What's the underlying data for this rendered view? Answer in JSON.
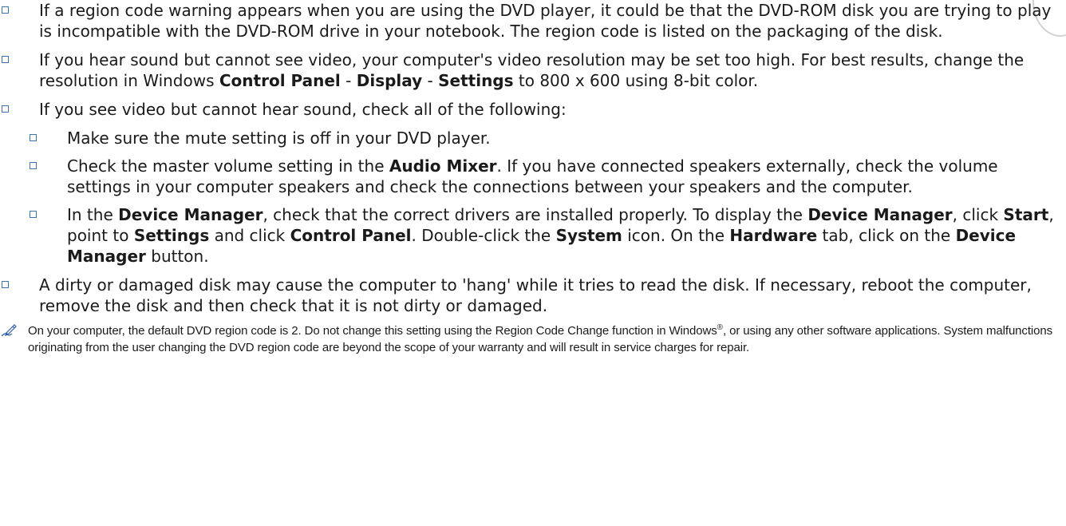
{
  "colors": {
    "bullet_border": "#3c72b5",
    "text": "#1a1a1a",
    "note_icon": "#2e5fa8"
  },
  "bullets": [
    {
      "text": "If a region code warning appears when you are using the DVD player, it could be that the DVD-ROM disk you are trying to play is incompatible with the DVD-ROM drive in your notebook. The region code is listed on the packaging of the disk."
    },
    {
      "t1": "If you hear sound but cannot see video, your computer's video resolution may be set too high. For best results, change the resolution in Windows ",
      "b1": "Control Panel",
      "t2": " - ",
      "b2": "Display",
      "t3": " - ",
      "b3": "Settings",
      "t4": " to 800 x 600 using 8-bit color."
    },
    {
      "text": "If you see video but cannot hear sound, check all of the following:",
      "sub": [
        {
          "text": "Make sure the mute setting is off in your DVD player."
        },
        {
          "t1": "Check the master volume setting in the ",
          "b1": "Audio Mixer",
          "t2": ". If you have connected speakers externally, check the volume settings in your computer speakers and check the connections between your speakers and the computer."
        },
        {
          "t1": "In the ",
          "b1": "Device Manager",
          "t2": ", check that the correct drivers are installed properly. To display the ",
          "b2": "Device Manager",
          "t3": ", click ",
          "b3": "Start",
          "t4": ", point to ",
          "b4": "Settings",
          "t5": " and click ",
          "b5": "Control Panel",
          "t6": ". Double-click the ",
          "b6": "System",
          "t7": " icon. On the ",
          "b7": "Hardware",
          "t8": " tab, click on the ",
          "b8": "Device Manager",
          "t9": " button."
        }
      ]
    },
    {
      "text": "A dirty or damaged disk may cause the computer to 'hang' while it tries to read the disk. If necessary, reboot the computer, remove the disk and then check that it is not dirty or damaged."
    }
  ],
  "note": {
    "icon": "pencil-note-icon",
    "t1": "On your computer, the default DVD region code is 2. Do not change this setting using the Region Code Change function in Windows",
    "reg": "®",
    "t2": ", or using any other software applications. System malfunctions originating from the user changing the DVD region code are beyond the scope of your warranty and will result in service charges for repair."
  }
}
